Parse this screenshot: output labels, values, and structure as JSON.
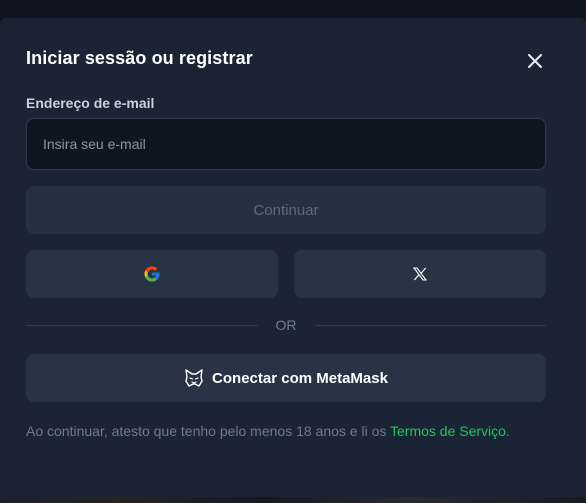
{
  "modal": {
    "title": "Iniciar sessão ou registrar",
    "close_icon": "close-icon"
  },
  "email": {
    "label": "Endereço de e-mail",
    "placeholder": "Insira seu e-mail",
    "value": ""
  },
  "continue_button": {
    "label": "Continuar",
    "enabled": false
  },
  "social": {
    "google_icon": "google-icon",
    "x_icon": "x-icon"
  },
  "divider": {
    "text": "OR"
  },
  "metamask_button": {
    "label": "Conectar com MetaMask",
    "icon": "metamask-fox-icon"
  },
  "terms": {
    "text": "Ao continuar, atesto que tenho pelo menos 18 anos e li os ",
    "link": "Termos de Serviço",
    "suffix": "."
  },
  "colors": {
    "accent": "#22c55e",
    "modal_bg": "#1b2434",
    "button_bg": "#283446"
  }
}
